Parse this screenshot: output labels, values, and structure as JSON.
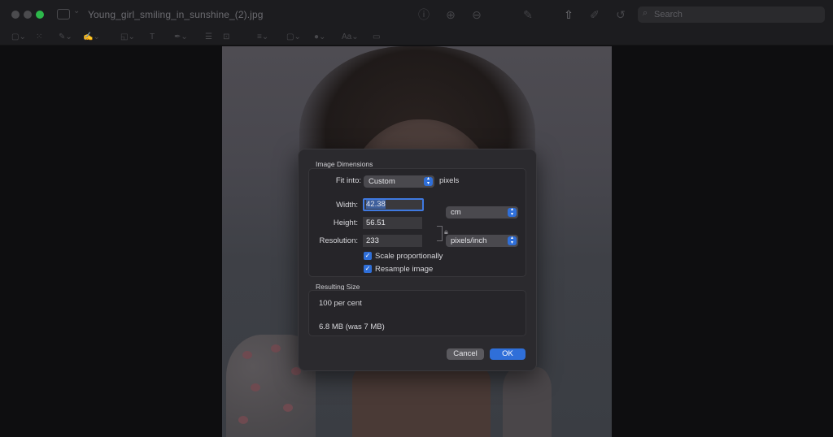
{
  "window": {
    "title": "Young_girl_smiling_in_sunshine_(2).jpg"
  },
  "toolbar": {
    "search_placeholder": "Search",
    "icons": [
      "sidebar-icon",
      "info-icon",
      "zoom-in-icon",
      "share-icon",
      "markup-icon",
      "rotate-icon",
      "search-icon"
    ],
    "markup_icons": [
      "selection-icon",
      "instant-alpha-icon",
      "sketch-icon",
      "draw-icon",
      "shapes-icon",
      "sign-icon",
      "adjust-color-icon",
      "adjust-size-icon",
      "border-icon",
      "color-icon",
      "text-style-icon",
      "note-icon"
    ],
    "text_style_label": "Aa"
  },
  "dialog": {
    "image_dimensions_title": "Image Dimensions",
    "fit_into_label": "Fit into:",
    "fit_into_value": "Custom",
    "fit_into_unit": "pixels",
    "width_label": "Width:",
    "width_value": "42.38",
    "height_label": "Height:",
    "height_value": "56.51",
    "size_unit_value": "cm",
    "resolution_label": "Resolution:",
    "resolution_value": "233",
    "resolution_unit_value": "pixels/inch",
    "scale_proportionally_label": "Scale proportionally",
    "scale_proportionally_checked": true,
    "resample_image_label": "Resample image",
    "resample_image_checked": true,
    "resulting_size_title": "Resulting Size",
    "resulting_percent": "100 per cent",
    "resulting_file_size": "6.8 MB (was 7 MB)",
    "cancel_label": "Cancel",
    "ok_label": "OK"
  },
  "colors": {
    "accent": "#2f6fd9",
    "dialog_bg": "#2b2a2e",
    "zoom_button": "#2db84b"
  }
}
